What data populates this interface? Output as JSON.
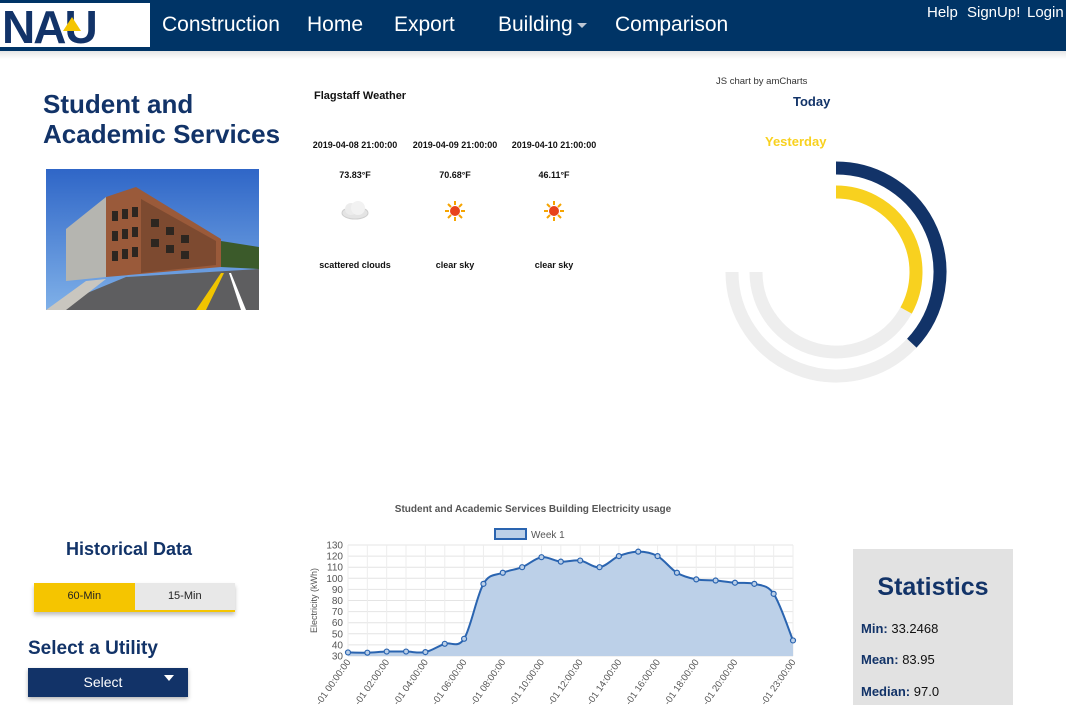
{
  "nav": {
    "brand": "NAU",
    "links": [
      "Construction",
      "Home",
      "Export",
      "Building",
      "Comparison"
    ],
    "right_links": [
      "Help",
      "SignUp!",
      "Login"
    ]
  },
  "building": {
    "title_line1": "Student and",
    "title_line2": "Academic Services"
  },
  "weather": {
    "title": "Flagstaff Weather",
    "days": [
      {
        "date": "2019-04-08 21:00:00",
        "temp": "73.83°F",
        "icon": "cloud-icon",
        "desc": "scattered clouds"
      },
      {
        "date": "2019-04-09 21:00:00",
        "temp": "70.68°F",
        "icon": "sun-icon",
        "desc": "clear sky"
      },
      {
        "date": "2019-04-10 21:00:00",
        "temp": "46.11°F",
        "icon": "sun-icon",
        "desc": "clear sky"
      }
    ]
  },
  "gauge": {
    "credit": "JS chart by amCharts",
    "today_label": "Today",
    "yesterday_label": "Yesterday",
    "today_fraction": 0.37,
    "yesterday_fraction": 0.33,
    "colors": {
      "today": "#123368",
      "yesterday": "#f8d11f",
      "track": "#eeeeee"
    }
  },
  "chart_data": {
    "type": "area",
    "title": "Student and Academic Services Building Electricity usage",
    "ylabel": "Electricity (kWh)",
    "ylim": [
      30,
      130
    ],
    "yticks": [
      30,
      40,
      50,
      60,
      70,
      80,
      90,
      100,
      110,
      120,
      130
    ],
    "x_labels": [
      "-01 00:00:00",
      "-01 02:00:00",
      "-01 04:00:00",
      "-01 06:00:00",
      "-01 08:00:00",
      "-01 10:00:00",
      "-01 12:00:00",
      "-01 14:00:00",
      "-01 16:00:00",
      "-01 18:00:00",
      "-01 20:00:00",
      "-01 23:00:00"
    ],
    "series": [
      {
        "name": "Week 1",
        "color": "#2a64b0",
        "fill": "#bcd0e8",
        "values": [
          33.2,
          33.0,
          34.0,
          34.0,
          33.5,
          41.0,
          45.5,
          95.0,
          105.0,
          110.0,
          119.0,
          115.0,
          116.0,
          110.0,
          120.0,
          124.0,
          120.0,
          105.0,
          99.0,
          98.0,
          96.0,
          95.0,
          86.0,
          44.0
        ]
      }
    ]
  },
  "historical": {
    "title": "Historical Data",
    "options": [
      "60-Min",
      "15-Min"
    ],
    "selected": "60-Min"
  },
  "utility": {
    "title": "Select a Utility",
    "value": "Select"
  },
  "stats": {
    "title": "Statistics",
    "rows": [
      {
        "label": "Min:",
        "value": "33.2468"
      },
      {
        "label": "Mean:",
        "value": "83.95"
      },
      {
        "label": "Median:",
        "value": "97.0"
      }
    ]
  }
}
